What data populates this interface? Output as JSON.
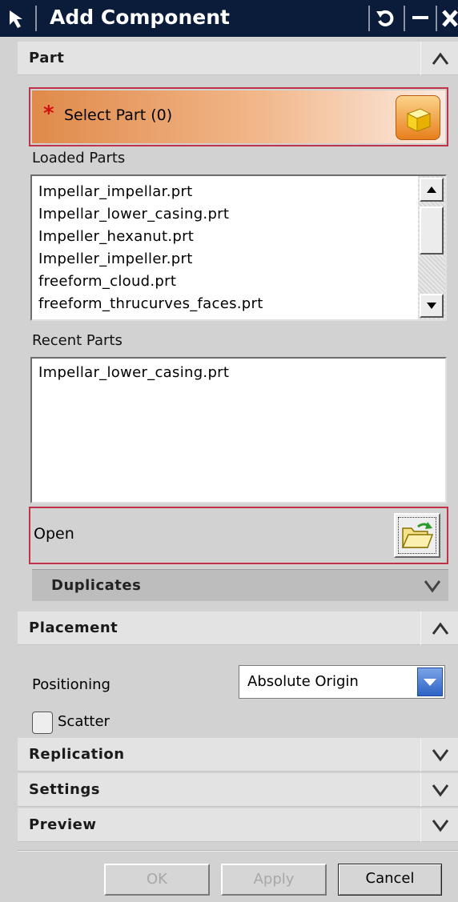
{
  "window": {
    "title": "Add Component",
    "buttons": [
      "reset-icon",
      "minimize-icon",
      "close-icon"
    ]
  },
  "part_group": {
    "title": "Part",
    "state": "expanded",
    "select": {
      "label": "Select Part (0)",
      "required_marker": "*"
    },
    "loaded_parts": {
      "label": "Loaded Parts",
      "items": [
        "Impellar_impellar.prt",
        "Impellar_lower_casing.prt",
        "Impeller_hexanut.prt",
        "Impeller_impeller.prt",
        "freeform_cloud.prt",
        "freeform_thrucurves_faces.prt"
      ]
    },
    "recent_parts": {
      "label": "Recent Parts",
      "items": [
        "Impellar_lower_casing.prt"
      ]
    },
    "open_label": "Open",
    "duplicates_label": "Duplicates"
  },
  "placement_group": {
    "title": "Placement",
    "state": "expanded",
    "positioning_label": "Positioning",
    "positioning_value": "Absolute Origin",
    "scatter_label": "Scatter",
    "scatter_checked": false
  },
  "collapsed_groups": [
    {
      "title": "Replication"
    },
    {
      "title": "Settings"
    },
    {
      "title": "Preview"
    }
  ],
  "buttons": {
    "ok": "OK",
    "apply": "Apply",
    "cancel": "Cancel"
  },
  "colors": {
    "titlebar": "#0b1c3a",
    "dialog_bg": "#d2d2d2",
    "highlight_border": "#c0324a",
    "select_gradient_start": "#e08a4a",
    "required_star": "#d11010"
  }
}
